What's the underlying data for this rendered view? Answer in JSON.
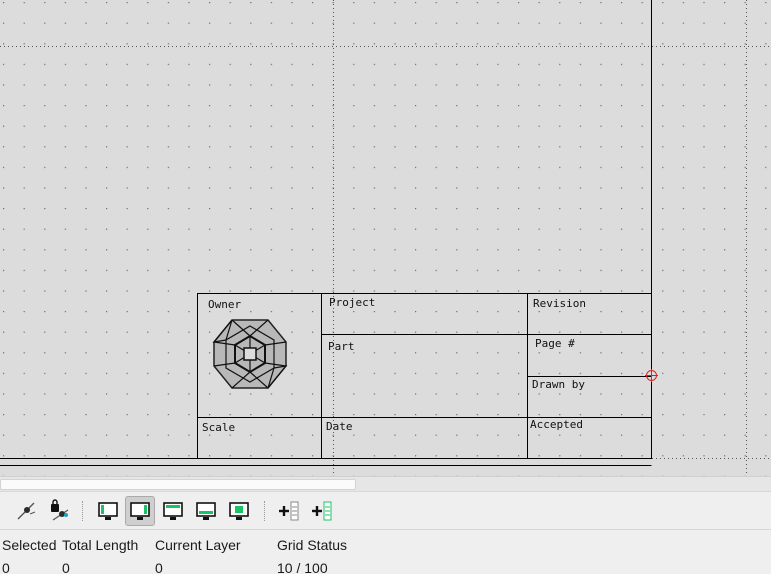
{
  "title_block": {
    "owner_label": "Owner",
    "project_label": "Project",
    "revision_label": "Revision",
    "part_label": "Part",
    "page_label": "Page #",
    "drawn_by_label": "Drawn by",
    "scale_label": "Scale",
    "date_label": "Date",
    "accepted_label": "Accepted"
  },
  "toolbar": {
    "buttons": [
      {
        "icon": "snap-endpoint-icon",
        "active": false
      },
      {
        "icon": "lock-relative-zero-icon",
        "active": false
      },
      {
        "icon": "view-screen-icon",
        "active": false
      },
      {
        "icon": "view-screen-active-icon",
        "active": true
      },
      {
        "icon": "view-screen-top-icon",
        "active": false
      },
      {
        "icon": "view-screen-bottom-icon",
        "active": false
      },
      {
        "icon": "view-screen-center-icon",
        "active": false
      },
      {
        "icon": "add-layer-icon",
        "active": false
      },
      {
        "icon": "add-layer-list-icon",
        "active": false
      }
    ]
  },
  "status": {
    "selected_label": "Selected",
    "selected_value": "0",
    "total_length_label": "Total Length",
    "total_length_value": "0",
    "current_layer_label": "Current Layer",
    "current_layer_value": "0",
    "grid_status_label": "Grid Status",
    "grid_status_value": "10 / 100"
  },
  "colors": {
    "canvas_bg": "#dcdcdc",
    "drawing_lines": "#000000",
    "cursor_marker": "#e02020",
    "screen_icon_accent": "#19c464"
  }
}
